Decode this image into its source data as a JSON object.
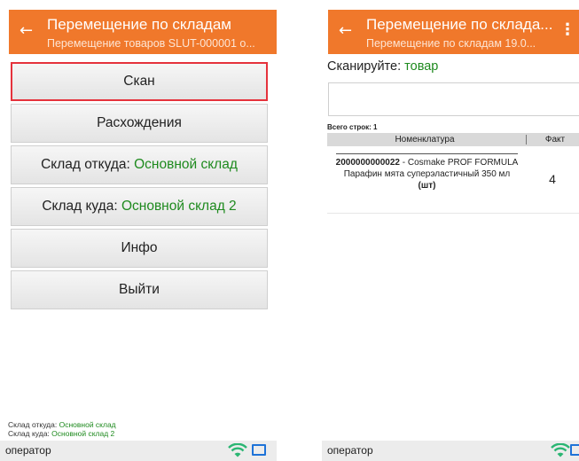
{
  "left_screen": {
    "title": "Перемещение по складам",
    "subtitle": "Перемещение товаров SLUT-000001 о...",
    "back_icon": "arrow-left-icon",
    "buttons": {
      "scan": "Скан",
      "discrepancies": "Расхождения",
      "warehouse_from_label": "Склад откуда: ",
      "warehouse_from_value": "Основной склад",
      "warehouse_to_label": "Склад куда: ",
      "warehouse_to_value": "Основной склад 2",
      "info": "Инфо",
      "exit": "Выйти"
    },
    "footer": {
      "from_label": "Склад откуда: ",
      "from_value": "Основной склад",
      "to_label": "Склад куда: ",
      "to_value": "Основной склад 2"
    },
    "status": {
      "user": "оператор"
    }
  },
  "right_screen": {
    "title": "Перемещение по склада...",
    "subtitle": "Перемещение по складам 19.0...",
    "back_icon": "arrow-left-icon",
    "menu_icon": "more-vert-icon",
    "scan_prompt_label": "Сканируйте: ",
    "scan_prompt_value": "товар",
    "rows_count": "Всего строк: 1",
    "table": {
      "columns": [
        "Номенклатура",
        "Факт"
      ],
      "rows": [
        {
          "barcode": "2000000000022",
          "name": " - Cosmake PROF FORMULA Парафин мята суперэластичный 350 мл",
          "unit": "(шт)",
          "fact": "4"
        }
      ]
    },
    "status": {
      "user": "оператор"
    }
  },
  "colors": {
    "appbar": "#f0782b",
    "accent_green": "#1e8a1e",
    "active_border": "#e5323c",
    "wifi": "#2bb673",
    "monitor": "#1e73d8"
  }
}
